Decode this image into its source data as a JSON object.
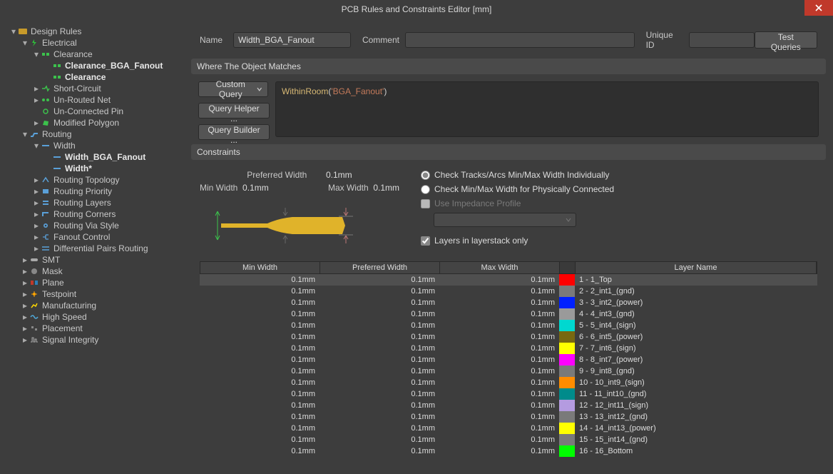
{
  "title": "PCB Rules and Constraints Editor [mm]",
  "tree": {
    "root": "Design Rules",
    "electrical": "Electrical",
    "clearance": "Clearance",
    "clearance_bga": "Clearance_BGA_Fanout",
    "clearance2": "Clearance",
    "short_circuit": "Short-Circuit",
    "unrouted_net": "Un-Routed Net",
    "unconnected_pin": "Un-Connected Pin",
    "modified_polygon": "Modified Polygon",
    "routing": "Routing",
    "width": "Width",
    "width_bga": "Width_BGA_Fanout",
    "width_star": "Width*",
    "routing_topology": "Routing Topology",
    "routing_priority": "Routing Priority",
    "routing_layers": "Routing Layers",
    "routing_corners": "Routing Corners",
    "routing_via_style": "Routing Via Style",
    "fanout_control": "Fanout Control",
    "diff_pairs": "Differential Pairs Routing",
    "smt": "SMT",
    "mask": "Mask",
    "plane": "Plane",
    "testpoint": "Testpoint",
    "manufacturing": "Manufacturing",
    "high_speed": "High Speed",
    "placement": "Placement",
    "signal_integrity": "Signal Integrity"
  },
  "form": {
    "name_lbl": "Name",
    "name_val": "Width_BGA_Fanout",
    "comment_lbl": "Comment",
    "comment_val": "",
    "uid_lbl": "Unique ID",
    "uid_val": "",
    "test_queries": "Test Queries"
  },
  "sections": {
    "where": "Where The Object Matches",
    "constraints": "Constraints"
  },
  "query": {
    "mode": "Custom Query",
    "helper": "Query Helper ...",
    "builder": "Query Builder ...",
    "fn": "WithinRoom",
    "arg": "'BGA_Fanout'"
  },
  "preview": {
    "pref_lbl": "Preferred Width",
    "pref_val": "0.1mm",
    "min_lbl": "Min Width",
    "min_val": "0.1mm",
    "max_lbl": "Max Width",
    "max_val": "0.1mm"
  },
  "options": {
    "opt1": "Check Tracks/Arcs Min/Max Width Individually",
    "opt2": "Check Min/Max Width for Physically Connected",
    "opt3": "Use Impedance Profile",
    "opt4": "Layers in layerstack only"
  },
  "grid": {
    "headers": {
      "min": "Min Width",
      "pref": "Preferred Width",
      "max": "Max Width",
      "layer": "Layer Name"
    },
    "rows": [
      {
        "min": "0.1mm",
        "pref": "0.1mm",
        "max": "0.1mm",
        "sw": "#ff0000",
        "layer": "1 - 1_Top"
      },
      {
        "min": "0.1mm",
        "pref": "0.1mm",
        "max": "0.1mm",
        "sw": "#7a7a7a",
        "layer": "2 - 2_int1_(gnd)"
      },
      {
        "min": "0.1mm",
        "pref": "0.1mm",
        "max": "0.1mm",
        "sw": "#0020ff",
        "layer": "3 - 3_int2_(power)"
      },
      {
        "min": "0.1mm",
        "pref": "0.1mm",
        "max": "0.1mm",
        "sw": "#9a9a9a",
        "layer": "4 - 4_int3_(gnd)"
      },
      {
        "min": "0.1mm",
        "pref": "0.1mm",
        "max": "0.1mm",
        "sw": "#00d8d0",
        "layer": "5 - 5_int4_(sign)"
      },
      {
        "min": "0.1mm",
        "pref": "0.1mm",
        "max": "0.1mm",
        "sw": "#786810",
        "layer": "6 - 6_int5_(power)"
      },
      {
        "min": "0.1mm",
        "pref": "0.1mm",
        "max": "0.1mm",
        "sw": "#ffff00",
        "layer": "7 - 7_int6_(sign)"
      },
      {
        "min": "0.1mm",
        "pref": "0.1mm",
        "max": "0.1mm",
        "sw": "#ff00ff",
        "layer": "8 - 8_int7_(power)"
      },
      {
        "min": "0.1mm",
        "pref": "0.1mm",
        "max": "0.1mm",
        "sw": "#7a7a7a",
        "layer": "9 - 9_int8_(gnd)"
      },
      {
        "min": "0.1mm",
        "pref": "0.1mm",
        "max": "0.1mm",
        "sw": "#ff8c00",
        "layer": "10 - 10_int9_(sign)"
      },
      {
        "min": "0.1mm",
        "pref": "0.1mm",
        "max": "0.1mm",
        "sw": "#008b8b",
        "layer": "11 - 11_int10_(gnd)"
      },
      {
        "min": "0.1mm",
        "pref": "0.1mm",
        "max": "0.1mm",
        "sw": "#b49be0",
        "layer": "12 - 12_int11_(sign)"
      },
      {
        "min": "0.1mm",
        "pref": "0.1mm",
        "max": "0.1mm",
        "sw": "#7a7a7a",
        "layer": "13 - 13_int12_(gnd)"
      },
      {
        "min": "0.1mm",
        "pref": "0.1mm",
        "max": "0.1mm",
        "sw": "#ffff00",
        "layer": "14 - 14_int13_(power)"
      },
      {
        "min": "0.1mm",
        "pref": "0.1mm",
        "max": "0.1mm",
        "sw": "#7a7a7a",
        "layer": "15 - 15_int14_(gnd)"
      },
      {
        "min": "0.1mm",
        "pref": "0.1mm",
        "max": "0.1mm",
        "sw": "#00ff00",
        "layer": "16 - 16_Bottom"
      }
    ]
  }
}
